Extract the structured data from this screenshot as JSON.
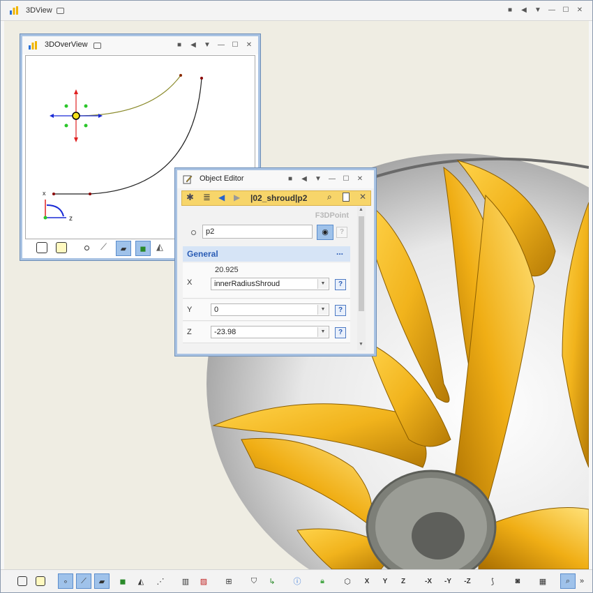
{
  "main_window": {
    "title": "3DView",
    "controls": [
      "■",
      "◀",
      "▼",
      "—",
      "☐",
      "✕"
    ]
  },
  "overview_window": {
    "title": "3DOverView",
    "controls": [
      "■",
      "◀",
      "▼",
      "—",
      "☐",
      "✕"
    ],
    "axes": {
      "x_label": "x",
      "z_label": "z"
    }
  },
  "object_editor": {
    "title": "Object Editor",
    "controls": [
      "■",
      "◀",
      "▼",
      "—",
      "☐",
      "✕"
    ],
    "path": "|02_shroud|p2",
    "object_type": "F3DPoint",
    "name_value": "p2",
    "section_title": "General",
    "section_more": "...",
    "help_label": "?",
    "fields": {
      "x": {
        "label": "X",
        "computed": "20.925",
        "value": "innerRadiusShroud"
      },
      "y": {
        "label": "Y",
        "value": "0"
      },
      "z": {
        "label": "Z",
        "value": "-23.98"
      }
    }
  },
  "colors": {
    "blade_yellow": "#f1b31c",
    "window_border": "#a9c3e3",
    "toolbar_yellow": "#f7d56a",
    "section_blue": "#d6e4f6",
    "active_button": "#9fc2ea"
  },
  "bottom_toolbar": {
    "axis_labels": [
      "X",
      "Y",
      "Z",
      "-X",
      "-Y",
      "-Z"
    ],
    "overflow": "»"
  }
}
